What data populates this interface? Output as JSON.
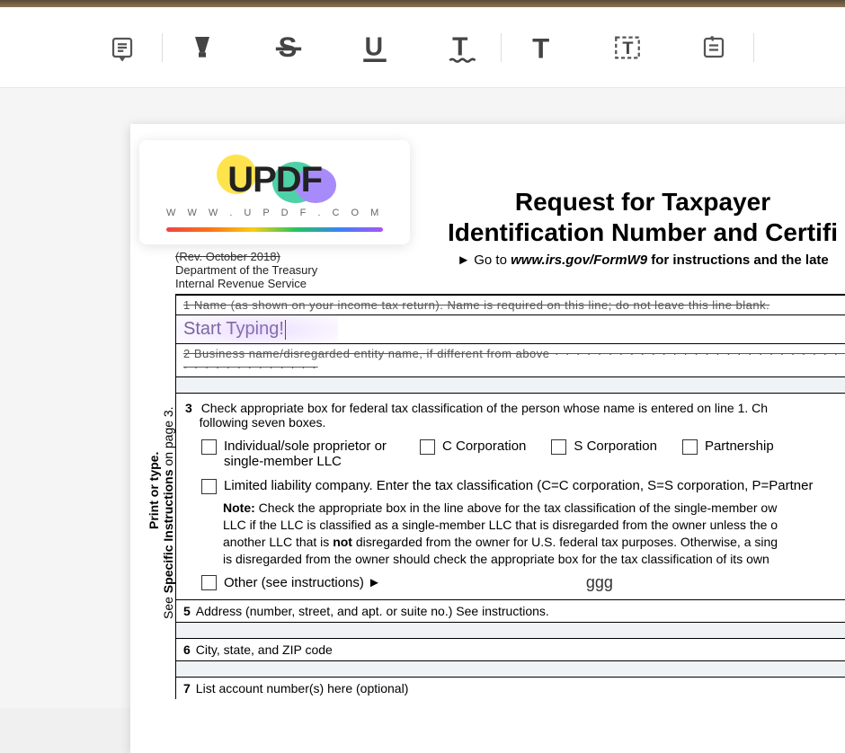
{
  "toolbar": {
    "tools": [
      "note",
      "highlighter",
      "strikethrough",
      "underline",
      "squiggly",
      "text",
      "textbox",
      "sticky"
    ]
  },
  "logo": {
    "word": "UPDF",
    "url": "W W W . U P D F . C O M"
  },
  "header": {
    "rev": "(Rev. October 2018)",
    "dept1": "Department of the Treasury",
    "dept2": "Internal Revenue Service",
    "title1": "Request for Taxpayer",
    "title2": "Identification Number and Certifi",
    "goto_prefix": "► Go to ",
    "goto_url": "www.irs.gov/FormW9",
    "goto_suffix": " for instructions and the late"
  },
  "side": {
    "print": "Print or type.",
    "see_prefix": "See ",
    "see_bold": "Specific Instructions",
    "see_suffix": " on page 3."
  },
  "lines": {
    "l1": "1  Name (as shown on your income tax return). Name is required on this line; do not leave this line blank.",
    "typing": "Start Typing!",
    "l2": "2  Business name/disregarded entity name, if different from above",
    "l3_num": "3",
    "l3_text": "Check appropriate box for federal tax classification of the person whose name is entered on line 1. Ch",
    "l3_text2": "following seven boxes.",
    "cb1": "Individual/sole proprietor or single-member LLC",
    "cb2": "C Corporation",
    "cb3": "S Corporation",
    "cb4": "Partnership",
    "llc": "Limited liability company. Enter the tax classification (C=C corporation, S=S corporation, P=Partner",
    "note_pre": "Note: ",
    "note_body1": "Check the appropriate box in the line above for the tax classification of the single-member ow",
    "note_body2": "LLC if the LLC is classified as a single-member LLC that is disregarded from the owner unless the o",
    "note_body3a": "another LLC that is ",
    "note_not": "not",
    "note_body3b": " disregarded from the owner for U.S. federal tax purposes. Otherwise, a sing",
    "note_body4": "is disregarded from the owner should check the appropriate box for the tax classification of its own",
    "other": "Other (see instructions) ►",
    "other_val": "ggg",
    "l5_num": "5",
    "l5": "Address (number, street, and apt. or suite no.) See instructions.",
    "l6_num": "6",
    "l6": "City, state, and ZIP code",
    "l7_num": "7",
    "l7": "List account number(s) here (optional)"
  }
}
